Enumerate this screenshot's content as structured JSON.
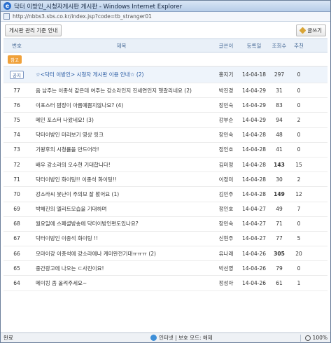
{
  "window": {
    "title": "닥터 이방인_시청자게시판 게시판 - Windows Internet Explorer",
    "url": "http://nbbs3.sbs.co.kr/index.jsp?code=tb_stranger01"
  },
  "toolbar": {
    "guide_button": "게시판 관리 기준 안내",
    "write_button": "글쓰기"
  },
  "table": {
    "headers": {
      "no": "번호",
      "subject": "제목",
      "writer": "글쓴이",
      "date": "등록일",
      "views": "조회수",
      "rec": "추천"
    },
    "special_badge": "참고",
    "notice": {
      "no": "공지",
      "subject": "☆<닥터 이방인> 시청자 게시판 이용 안내☆ (2)",
      "writer": "홍지기",
      "date": "14-04-18",
      "views": "297",
      "rec": "0"
    },
    "rows": [
      {
        "no": "77",
        "subject": "음 남주는 이종석 같은데 여주는 강소라인지 진세연인지 헷갈리네요 (2)",
        "writer": "박진경",
        "date": "14-04-29",
        "views": "31",
        "rec": "0"
      },
      {
        "no": "76",
        "subject": "이포스터 팜장이 아름예쁨지않나요? (4)",
        "writer": "장민숙",
        "date": "14-04-29",
        "views": "83",
        "rec": "0"
      },
      {
        "no": "75",
        "subject": "메인 포스터 나왔네요! (3)",
        "writer": "강부순",
        "date": "14-04-29",
        "views": "94",
        "rec": "2"
      },
      {
        "no": "74",
        "subject": "닥터이방인 미리보기 영상 링크",
        "writer": "장민숙",
        "date": "14-04-28",
        "views": "48",
        "rec": "0"
      },
      {
        "no": "73",
        "subject": "기왕후의 시청률을 만드어라!",
        "writer": "정인호",
        "date": "14-04-28",
        "views": "41",
        "rec": "0"
      },
      {
        "no": "72",
        "subject": "배우 강소라의 오수현 기대합니다!",
        "writer": "김미정",
        "date": "14-04-28",
        "views": "143",
        "rec": "15",
        "bold_views": true
      },
      {
        "no": "71",
        "subject": "닥터이방인 화이팅!! 이종석 화이팅!!",
        "writer": "이정미",
        "date": "14-04-28",
        "views": "30",
        "rec": "2"
      },
      {
        "no": "70",
        "subject": "강소라씨 뭇난이 주의보 잘 봤어요 (1)",
        "writer": "김민주",
        "date": "14-04-28",
        "views": "149",
        "rec": "12",
        "bold_views": true
      },
      {
        "no": "69",
        "subject": "박해진의 엘리트모습을 기대하며",
        "writer": "정인호",
        "date": "14-04-27",
        "views": "49",
        "rec": "7"
      },
      {
        "no": "68",
        "subject": "월요일에 스페셜방송에 닥터이방인편도있나요?",
        "writer": "장민숙",
        "date": "14-04-27",
        "views": "71",
        "rec": "0"
      },
      {
        "no": "67",
        "subject": "닥터이방인 이종석 화이팅 !!",
        "writer": "신현주",
        "date": "14-04-27",
        "views": "77",
        "rec": "5"
      },
      {
        "no": "66",
        "subject": "모마이강 이종석에 강소라에나 케미완전기대ㅠㅠㅠ (2)",
        "writer": "유나래",
        "date": "14-04-26",
        "views": "305",
        "rec": "20",
        "bold_views": true
      },
      {
        "no": "65",
        "subject": "중간광고에 나오는 ㄷ사진이요!",
        "writer": "박선영",
        "date": "14-04-26",
        "views": "79",
        "rec": "0"
      },
      {
        "no": "64",
        "subject": "메이킹 좀 올려주세요~",
        "writer": "정성아",
        "date": "14-04-26",
        "views": "61",
        "rec": "1"
      }
    ]
  },
  "statusbar": {
    "left": "완료",
    "zone": "인터넷 | 보호 모드: 해제",
    "zoom": "100%"
  }
}
